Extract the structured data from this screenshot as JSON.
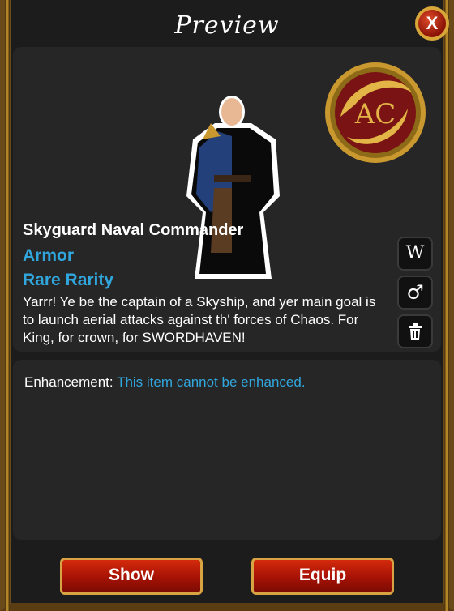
{
  "window": {
    "title": "Preview",
    "close_label": "X"
  },
  "item": {
    "name": "Skyguard Naval Commander",
    "type": "Armor",
    "rarity": "Rare Rarity",
    "description": "Yarrr! Ye be the captain of a Skyship, and yer main goal is to launch aerial attacks against th' forces of Chaos. For King, for crown, for SWORDHAVEN!",
    "emblem_text": "AC"
  },
  "side_buttons": {
    "wiki_label": "W",
    "gender_icon": "male-symbol-icon",
    "gender_glyph": "♂",
    "trash_icon": "trash-icon"
  },
  "enhancement": {
    "label": "Enhancement:",
    "value": "This item cannot be enhanced."
  },
  "actions": {
    "show_label": "Show",
    "equip_label": "Equip"
  },
  "colors": {
    "accent_blue": "#30a6dd",
    "button_red": "#a51205",
    "gold": "#d7a343"
  }
}
